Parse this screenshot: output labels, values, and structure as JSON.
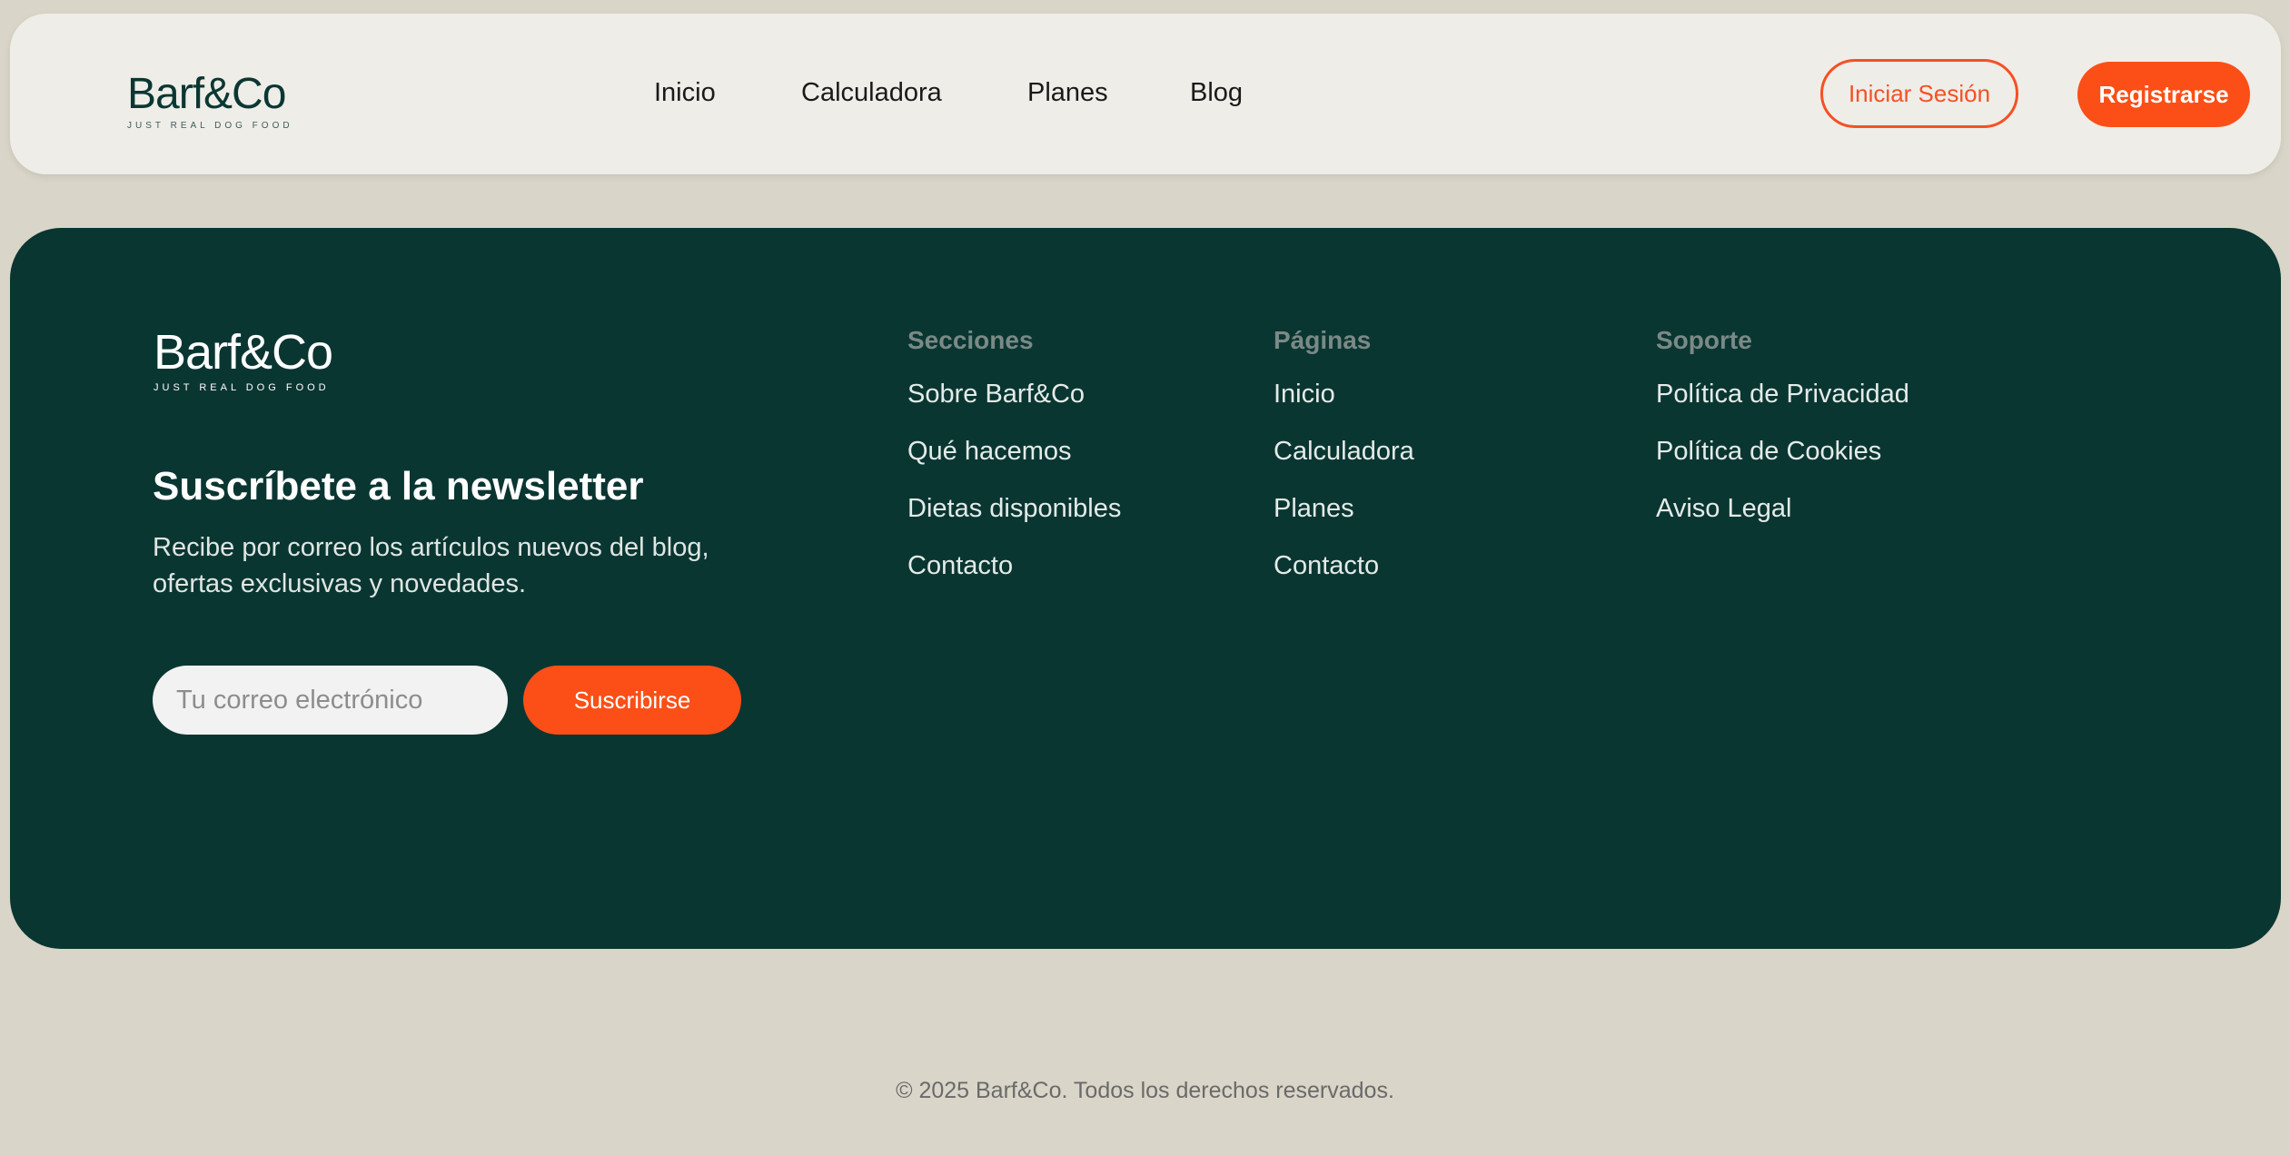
{
  "colors": {
    "page_bg": "#d9d5c8",
    "header_bg": "#efede8",
    "footer_bg": "#0a3632",
    "accent": "#fb4f17",
    "logo_dark": "#0b3733"
  },
  "header": {
    "logo_word": "Barf&Co",
    "logo_tagline": "JUST REAL DOG FOOD",
    "nav": [
      {
        "label": "Inicio"
      },
      {
        "label": "Calculadora"
      },
      {
        "label": "Planes"
      },
      {
        "label": "Blog"
      }
    ],
    "login_label": "Iniciar Sesión",
    "register_label": "Registrarse"
  },
  "footer": {
    "logo_word": "Barf&Co",
    "logo_tagline": "JUST REAL DOG FOOD",
    "newsletter": {
      "title": "Suscríbete a la newsletter",
      "description": "Recibe por correo los artículos nuevos del blog, ofertas exclusivas y novedades.",
      "email_placeholder": "Tu correo electrónico",
      "subscribe_label": "Suscribirse"
    },
    "columns": [
      {
        "heading": "Secciones",
        "links": [
          "Sobre Barf&Co",
          "Qué hacemos",
          "Dietas disponibles",
          "Contacto"
        ]
      },
      {
        "heading": "Páginas",
        "links": [
          "Inicio",
          "Calculadora",
          "Planes",
          "Contacto"
        ]
      },
      {
        "heading": "Soporte",
        "links": [
          "Política de Privacidad",
          "Política de Cookies",
          "Aviso Legal"
        ]
      }
    ]
  },
  "copyright": "© 2025 Barf&Co. Todos los derechos reservados."
}
